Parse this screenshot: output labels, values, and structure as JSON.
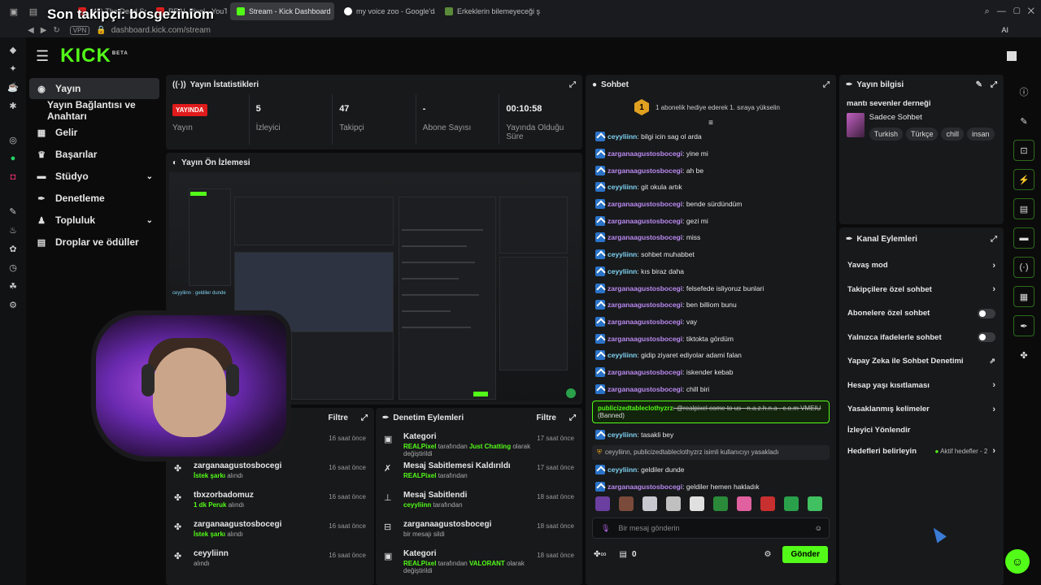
{
  "overlay": {
    "title": "Son takipçi: bosgeziniom"
  },
  "browser": {
    "tabs": [
      {
        "label": "(45) The Dead South - In"
      },
      {
        "label": "REAL Pixel - YouTube"
      },
      {
        "label": "Stream - Kick Dashboard"
      },
      {
        "label": "my voice zoo - Google'da"
      },
      {
        "label": "Erkeklerin bilemeyeceği şe"
      }
    ],
    "vpn": "VPN",
    "url": "dashboard.kick.com/stream",
    "ai_label": "AI"
  },
  "brand": {
    "logo": "KICK",
    "beta": "BETA"
  },
  "sidenav": {
    "items": [
      {
        "label": "Yayın"
      },
      {
        "label": "Yayın Bağlantısı ve Anahtarı"
      },
      {
        "label": "Gelir"
      },
      {
        "label": "Başarılar"
      },
      {
        "label": "Stüdyo"
      },
      {
        "label": "Denetleme"
      },
      {
        "label": "Topluluk"
      },
      {
        "label": "Droplar ve ödüller"
      }
    ]
  },
  "stats": {
    "title": "Yayın İstatistikleri",
    "live_badge": "YAYINDA",
    "items": [
      {
        "value": "",
        "label": "Yayın"
      },
      {
        "value": "5",
        "label": "İzleyici"
      },
      {
        "value": "47",
        "label": "Takipçi"
      },
      {
        "value": "-",
        "label": "Abone Sayısı"
      },
      {
        "value": "00:10:58",
        "label": "Yayında Olduğu Süre"
      }
    ]
  },
  "preview": {
    "title": "Yayın Ön İzlemesi"
  },
  "activity": {
    "filter": "Filtre",
    "items": [
      {
        "name": "",
        "sub_green": "",
        "sub": "",
        "time": "16 saat önce"
      },
      {
        "name": "zarganaagustosbocegi",
        "sub_green": "İstek şarkı",
        "sub": "alındı",
        "time": "16 saat önce"
      },
      {
        "name": "tbxzorbadomuz",
        "sub_green": "1 dk Peruk",
        "sub": "alındı",
        "time": "16 saat önce"
      },
      {
        "name": "zarganaagustosbocegi",
        "sub_green": "İstek şarkı",
        "sub": "alındı",
        "time": "16 saat önce"
      },
      {
        "name": "ceyyliinn",
        "sub_green": "",
        "sub": "alındı",
        "time": "16 saat önce"
      }
    ]
  },
  "moderation": {
    "title": "Denetim Eylemleri",
    "filter": "Filtre",
    "items": [
      {
        "name": "Kategori",
        "actor": "REALPixel",
        "mid": "tarafından",
        "target": "Just Chatting",
        "end": "olarak değiştirildi",
        "time": "17 saat önce"
      },
      {
        "name": "Mesaj Sabitlemesi Kaldırıldı",
        "actor": "REALPixel",
        "mid": "tarafından",
        "target": "",
        "end": "",
        "time": "17 saat önce"
      },
      {
        "name": "Mesaj Sabitlendi",
        "actor": "ceyyliinn",
        "mid": "tarafından",
        "target": "",
        "end": "",
        "time": "18 saat önce"
      },
      {
        "name": "zarganaagustosbocegi",
        "actor": "",
        "mid": "bir mesajı sildi",
        "target": "",
        "end": "",
        "time": "18 saat önce"
      },
      {
        "name": "Kategori",
        "actor": "REALPixel",
        "mid": "tarafından",
        "target": "VALORANT",
        "end": "olarak değiştirildi",
        "time": "18 saat önce"
      }
    ]
  },
  "chat": {
    "title": "Sohbet",
    "pinned": "1 abonelik hediye ederek 1. sıraya yükselin",
    "pinned_rank": "1",
    "messages": [
      {
        "user": "ceyyliinn",
        "text": ": bilgi icin sag ol arda",
        "c": "u1"
      },
      {
        "user": "zarganaagustosbocegi",
        "text": ": yine mi",
        "c": "u2"
      },
      {
        "user": "zarganaagustosbocegi",
        "text": ": ah be",
        "c": "u2"
      },
      {
        "user": "ceyyliinn",
        "text": ": git okula artık",
        "c": "u1"
      },
      {
        "user": "zarganaagustosbocegi",
        "text": ": bende sürdündüm",
        "c": "u2"
      },
      {
        "user": "zarganaagustosbocegi",
        "text": ": gezi mi",
        "c": "u2"
      },
      {
        "user": "zarganaagustosbocegi",
        "text": ": miss",
        "c": "u2"
      },
      {
        "user": "ceyyliinn",
        "text": ": sohbet muhabbet",
        "c": "u1"
      },
      {
        "user": "ceyyliinn",
        "text": ": kıs biraz daha",
        "c": "u1"
      },
      {
        "user": "zarganaagustosbocegi",
        "text": ": felsefede isliyoruz bunlari",
        "c": "u2"
      },
      {
        "user": "zarganaagustosbocegi",
        "text": ": ben billiom bunu",
        "c": "u2"
      },
      {
        "user": "zarganaagustosbocegi",
        "text": ": vay",
        "c": "u2"
      },
      {
        "user": "zarganaagustosbocegi",
        "text": ": tiktokta gördüm",
        "c": "u2"
      },
      {
        "user": "ceyyliinn",
        "text": ": gidip ziyaret ediyolar adami falan",
        "c": "u1"
      },
      {
        "user": "zarganaagustosbocegi",
        "text": ": iskender kebab",
        "c": "u2"
      },
      {
        "user": "zarganaagustosbocegi",
        "text": ": chill biri",
        "c": "u2"
      }
    ],
    "banned_user": "publicizedtableclothyzrz",
    "banned_text": ": @realpixel come to us - n.a.z.h.n.a . c.o.m VMEIU",
    "banned_tag": "(Banned)",
    "after": [
      {
        "user": "ceyyliinn",
        "text": ": tasakli bey",
        "c": "u1"
      }
    ],
    "system": "ceyyliinn, publicizedtableclothyzrz isimli kullanıcıyı yasakladı",
    "after2": [
      {
        "user": "ceyyliinn",
        "text": ": geldiler dunde",
        "c": "u1"
      },
      {
        "user": "zarganaagustosbocegi",
        "text": ": geldiler hemen hakladık",
        "c": "u2"
      }
    ],
    "input_placeholder": "Bir mesaj gönderin",
    "points": "0",
    "send": "Gönder",
    "emote_colors": [
      "#6a3fa0",
      "#7a4a3a",
      "#c8c8d0",
      "#c0c0c0",
      "#e0e0e0",
      "#2a8a3a",
      "#e060a0",
      "#c83030",
      "#2aa04a",
      "#40c060"
    ]
  },
  "stream_info": {
    "title": "Yayın bilgisi",
    "stream_title": "mantı sevenler derneği",
    "category": "Sadece Sohbet",
    "tags": [
      "Turkish",
      "Türkçe",
      "chill",
      "insan"
    ]
  },
  "channel_actions": {
    "title": "Kanal Eylemleri",
    "items": [
      {
        "label": "Yavaş mod",
        "kind": "chevron"
      },
      {
        "label": "Takipçilere özel sohbet",
        "kind": "chevron"
      },
      {
        "label": "Abonelere özel sohbet",
        "kind": "toggle"
      },
      {
        "label": "Yalnızca ifadelerle sohbet",
        "kind": "toggle"
      },
      {
        "label": "Yapay Zeka ile Sohbet Denetimi",
        "kind": "external"
      },
      {
        "label": "Hesap yaşı kısıtlaması",
        "kind": "chevron"
      },
      {
        "label": "Yasaklanmış kelimeler",
        "kind": "chevron"
      },
      {
        "label": "İzleyici Yönlendir",
        "kind": "none"
      },
      {
        "label": "Hedefleri belirleyin",
        "kind": "goals"
      }
    ],
    "goals_status": "Aktif hedefler - 2"
  },
  "preview_inner": {
    "overlay_text": "ceyyliinn : geldiler dunde"
  },
  "colors": {
    "accent": "#53fc18",
    "live": "#e01b1b",
    "panel": "#18191b",
    "bg": "#0b0b0c"
  }
}
